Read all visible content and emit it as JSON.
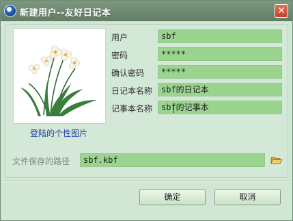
{
  "window": {
    "title": "新建用户--友好日记本",
    "close_label": "✕"
  },
  "picture": {
    "caption": "登陆的个性图片"
  },
  "form": {
    "fields": [
      {
        "label": "用户",
        "value": "sbf"
      },
      {
        "label": "密码",
        "value": "*****"
      },
      {
        "label": "确认密码",
        "value": "*****"
      },
      {
        "label": "日记本名称",
        "value": "sbf的日记本"
      },
      {
        "label": "记事本名称",
        "value": "sbf的记事本"
      }
    ]
  },
  "path": {
    "label": "文件保存的路径",
    "value": "sbf.kbf",
    "browse_icon": "folder-open-icon"
  },
  "buttons": {
    "ok": "确定",
    "cancel": "取消"
  },
  "colors": {
    "titlebar": "#6f8a72",
    "background": "#d2e6d5",
    "field": "#9bd48f",
    "close": "#d4553c",
    "caption": "#1f3ea3"
  }
}
